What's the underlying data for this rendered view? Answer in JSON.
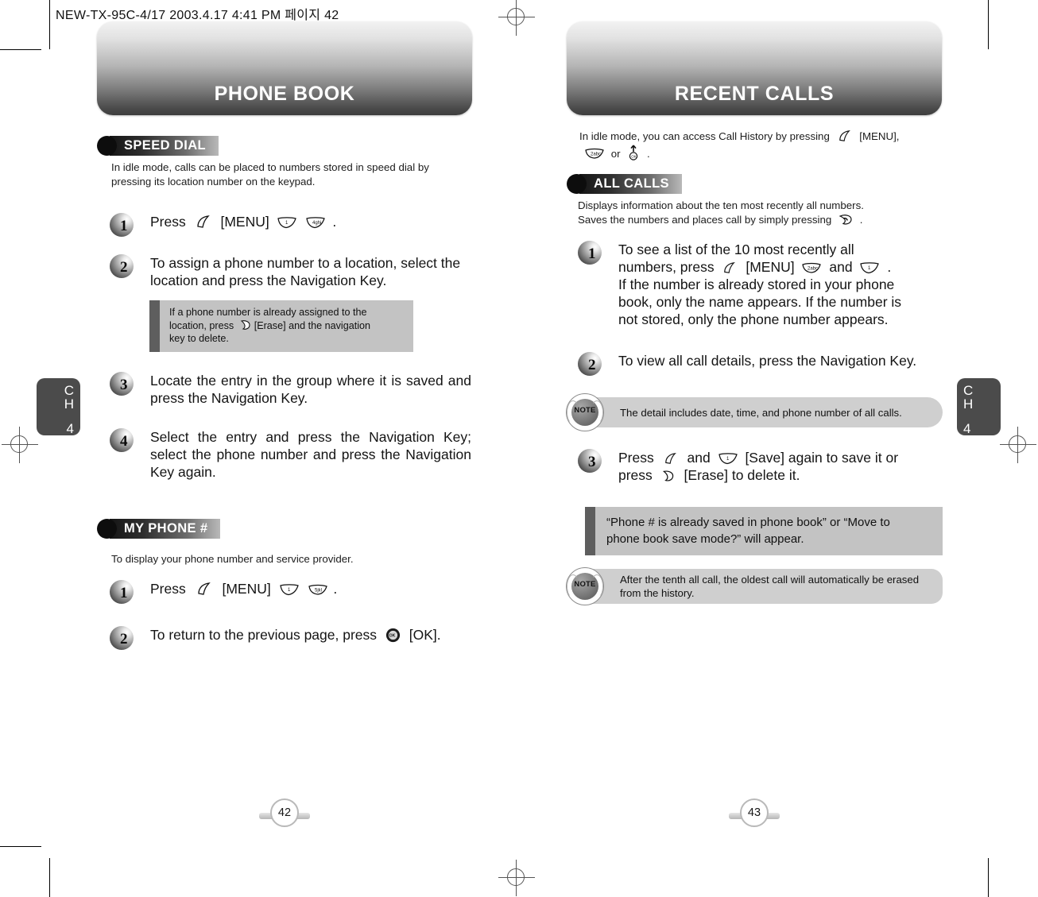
{
  "slug": "NEW-TX-95C-4/17  2003.4.17 4:41 PM  페이지 42",
  "left_page": {
    "banner_title": "PHONE BOOK",
    "chapter_tab": {
      "ch": "CH",
      "number": "4"
    },
    "folio": "42",
    "sections": [
      {
        "heading": "SPEED DIAL",
        "intro": "In idle mode, calls can be placed to numbers stored in speed dial by pressing its location number on the keypad.",
        "steps": [
          {
            "num": "1",
            "text_before": "Press",
            "text_after": "."
          },
          {
            "num": "2",
            "text": "To assign a phone number to a location, select the location and press the Navigation Key."
          },
          {
            "num": "3",
            "text": "Locate the entry in the group where it is saved and press the Navigation Key."
          },
          {
            "num": "4",
            "text": "Select the entry and press the Navigation Key; select the phone number and press the Navigation Key again."
          }
        ],
        "callout": "If a phone number is already assigned to the location, press  [Erase] and the navigation key to delete.",
        "callout_part1": "If a phone number is already assigned to the",
        "callout_part2a": "location, press",
        "callout_part2b": "[Erase] and the navigation",
        "callout_part3": "key to delete."
      },
      {
        "heading": "MY PHONE #",
        "intro": "To display your phone number and service provider.",
        "steps": [
          {
            "num": "1",
            "text_before": "Press",
            "text_after": "."
          },
          {
            "num": "2",
            "text_before": "To return to the previous page, press",
            "text_after": "[OK]."
          }
        ]
      }
    ],
    "labels": {
      "menu": "[MENU]",
      "erase": "[Erase]",
      "ok": "[OK]"
    }
  },
  "right_page": {
    "banner_title": "RECENT CALLS",
    "chapter_tab": {
      "ch": "CH",
      "number": "4"
    },
    "folio": "43",
    "intro_line1": "In idle mode, you can access Call History by pressing",
    "intro_line1_tail": "[MENU],",
    "intro_line2_mid": "or",
    "intro_line2_tail": ".",
    "sections": [
      {
        "heading": "ALL CALLS",
        "intro_line1": "Displays information about the ten most recently all numbers.",
        "intro_line2": "Saves the numbers and places call by simply pressing",
        "intro_line2_tail": ".",
        "steps": [
          {
            "num": "1",
            "line1": "To see a list of the 10 most recently all",
            "line2a": "numbers, press",
            "line2b": "[MENU]",
            "line2c": "and",
            "line2d": ".",
            "line3": "If the number is already stored in your phone",
            "line4": "book, only the name appears. If the number is",
            "line5": "not stored, only the phone number appears."
          },
          {
            "num": "2",
            "text": "To view all call details, press the Navigation Key."
          },
          {
            "num": "3",
            "line1a": "Press",
            "line1b": "and",
            "line1c": "[Save] again to save it or",
            "line2a": "press",
            "line2b": "[Erase] to delete it."
          }
        ]
      }
    ],
    "notes": [
      {
        "badge": "NOTE",
        "text": "The detail includes date, time, and phone number of all calls."
      },
      {
        "badge": "NOTE",
        "text": "After the tenth all call, the oldest call will automatically be erased from the history."
      }
    ],
    "callout": "“Phone # is already saved in phone book” or “Move to phone book save mode?” will appear.",
    "callout_line1": "“Phone # is already saved in phone book” or “Move to",
    "callout_line2": "phone book save mode?” will appear.",
    "labels": {
      "save": "[Save]",
      "erase": "[Erase]",
      "menu": "[MENU]"
    }
  },
  "icons": {
    "menu_key": "menu-key-icon",
    "key_1": "keypad-1-icon",
    "key_2": "keypad-2abc-icon",
    "key_4": "keypad-4ghi-icon",
    "key_5": "keypad-5jkl-icon",
    "send_key": "send-key-icon",
    "erase_key": "erase-key-icon",
    "ok_key": "ok-key-icon",
    "nav_up_key": "nav-up-key-icon"
  },
  "colors": {
    "banner_dark": "#3e3e3e",
    "banner_light": "#f2f2f2",
    "callout_bg": "#c3c3c3",
    "callout_tab": "#5e5e5e",
    "note_bg": "#cfcfcf",
    "chapter_tab": "#4b4b4b"
  }
}
